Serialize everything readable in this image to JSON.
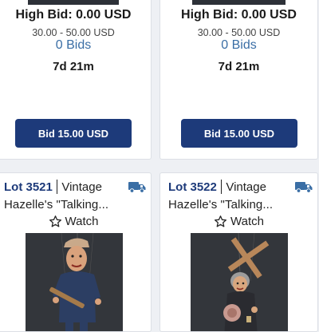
{
  "lots_top": [
    {
      "high_bid": "High Bid: 0.00 USD",
      "estimate": "30.00 - 50.00 USD",
      "bids": "0 Bids",
      "time_left": "7d 21m",
      "bid_button": "Bid 15.00 USD"
    },
    {
      "high_bid": "High Bid: 0.00 USD",
      "estimate": "30.00 - 50.00 USD",
      "bids": "0 Bids",
      "time_left": "7d 21m",
      "bid_button": "Bid 15.00 USD"
    }
  ],
  "lots_bottom": [
    {
      "lot_number": "Lot 3521",
      "category": "Vintage",
      "title": "Hazelle's \"Talking...",
      "watch_label": "Watch",
      "shipping_icon": "truck-icon",
      "photo_icon": "marionette-photo"
    },
    {
      "lot_number": "Lot 3522",
      "category": "Vintage",
      "title": "Hazelle's \"Talking...",
      "watch_label": "Watch",
      "shipping_icon": "truck-icon",
      "photo_icon": "marionette-photo"
    }
  ],
  "colors": {
    "accent": "#1d3a7a",
    "link": "#3a6ea5",
    "shipping_icon": "#3a6ea5"
  }
}
